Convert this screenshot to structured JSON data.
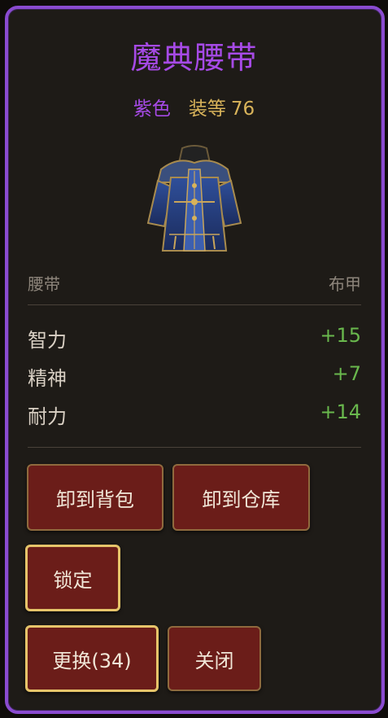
{
  "item": {
    "name": "魔典腰带",
    "quality": "紫色",
    "item_level_label": "装等",
    "item_level": "76",
    "slot": "腰带",
    "armor_type": "布甲",
    "icon": "robe-armor-icon"
  },
  "stats": [
    {
      "name": "智力",
      "value": "+15"
    },
    {
      "name": "精神",
      "value": "+7"
    },
    {
      "name": "耐力",
      "value": "+14"
    }
  ],
  "buttons": {
    "unequip_to_bag": "卸到背包",
    "unequip_to_bank": "卸到仓库",
    "lock": "锁定",
    "replace": "更换(34)",
    "close": "关闭"
  },
  "colors": {
    "purple": "#a64ae6",
    "gold": "#d8b35a",
    "stat_green": "#69b84d",
    "button_bg": "#6b1d19"
  }
}
